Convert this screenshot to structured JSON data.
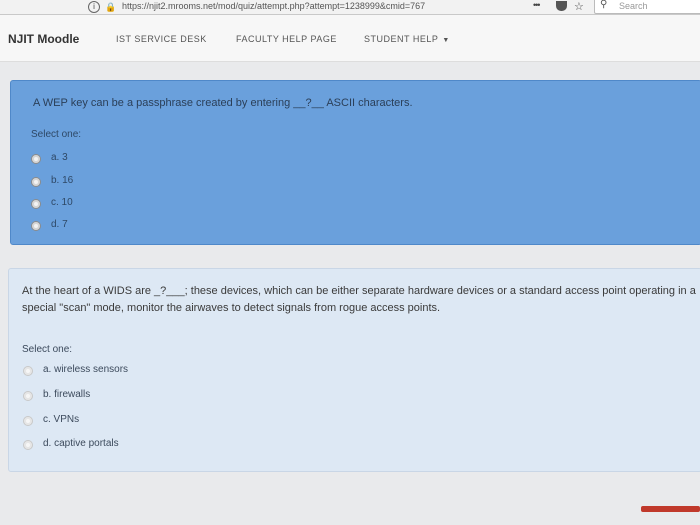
{
  "browser": {
    "url": "https://njit2.mrooms.net/mod/quiz/attempt.php?attempt=1238999&cmid=767",
    "more_label": "•••",
    "search_placeholder": "Search"
  },
  "navbar": {
    "brand": "NJIT Moodle",
    "links": [
      "IST SERVICE DESK",
      "FACULTY HELP PAGE",
      "STUDENT HELP"
    ]
  },
  "questions": [
    {
      "text": "A WEP key can be a passphrase created by entering __?__ ASCII characters.",
      "select_label": "Select one:",
      "options": [
        "a. 3",
        "b. 16",
        "c. 10",
        "d. 7"
      ]
    },
    {
      "text": "At the heart of a WIDS are _?___; these devices, which can be either separate hardware devices or a standard access point operating in a special \"scan\" mode, monitor the airwaves to detect signals from rogue access points.",
      "select_label": "Select one:",
      "options": [
        "a. wireless sensors",
        "b. firewalls",
        "c. VPNs",
        "d. captive portals"
      ]
    }
  ],
  "colors": {
    "question1_bg": "#6aa0dc",
    "question2_bg": "#dde8f4",
    "accent_red": "#c0392b"
  }
}
